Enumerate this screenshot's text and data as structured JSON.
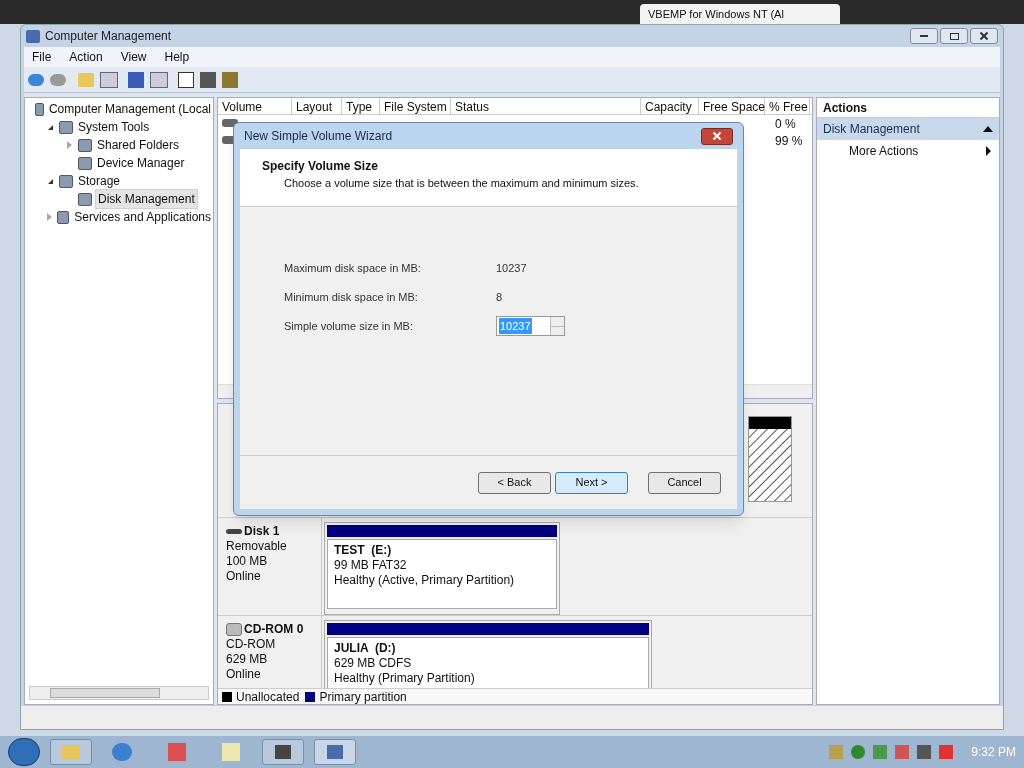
{
  "browser_tab": {
    "title": "VBEMP for Windows NT (Al"
  },
  "window": {
    "title": "Computer Management"
  },
  "menu": [
    "File",
    "Action",
    "View",
    "Help"
  ],
  "tree": [
    {
      "label": "Computer Management (Local",
      "selected": false,
      "children": [
        {
          "label": "System Tools",
          "expanded": true,
          "selected": false,
          "children": [
            {
              "label": "Shared Folders",
              "expanded": false,
              "selected": false
            },
            {
              "label": "Device Manager",
              "selected": false
            }
          ]
        },
        {
          "label": "Storage",
          "expanded": true,
          "selected": false,
          "children": [
            {
              "label": "Disk Management",
              "selected": true
            }
          ]
        },
        {
          "label": "Services and Applications",
          "expanded": false,
          "selected": false
        }
      ]
    }
  ],
  "volume_table": {
    "columns": [
      "Volume",
      "Layout",
      "Type",
      "File System",
      "Status",
      "Capacity",
      "Free Space",
      "% Free"
    ],
    "rows": [
      {
        "percent_free": "0 %"
      },
      {
        "percent_free": "99 %"
      }
    ]
  },
  "disks": [
    {
      "kind": "disk",
      "partition": {
        "color": "#000000"
      }
    },
    {
      "kind": "removable",
      "name": "Disk 1",
      "type": "Removable",
      "size": "100 MB",
      "status": "Online",
      "partition": {
        "color": "#000080",
        "label": "TEST  (E:)",
        "detail": "99 MB FAT32",
        "health": "Healthy (Active, Primary Partition)"
      }
    },
    {
      "kind": "cdrom",
      "name": "CD-ROM 0",
      "type": "CD-ROM",
      "size": "629 MB",
      "status": "Online",
      "partition": {
        "color": "#000080",
        "label": "JULIA  (D:)",
        "detail": "629 MB CDFS",
        "health": "Healthy (Primary Partition)"
      }
    }
  ],
  "legend": [
    {
      "label": "Unallocated",
      "color": "#000000"
    },
    {
      "label": "Primary partition",
      "color": "#000080"
    }
  ],
  "actions": {
    "title": "Actions",
    "section": "Disk Management",
    "expanded": true,
    "items": [
      "More Actions"
    ]
  },
  "dialog": {
    "title": "New Simple Volume Wizard",
    "heading": "Specify Volume Size",
    "subheading": "Choose a volume size that is between the maximum and minimum sizes.",
    "fields": [
      {
        "kind": "text",
        "label": "Maximum disk space in MB:",
        "value": "10237"
      },
      {
        "kind": "text",
        "label": "Minimum disk space in MB:",
        "value": "8"
      },
      {
        "kind": "spinner",
        "label": "Simple volume size in MB:",
        "value": "10237",
        "selected": true
      }
    ],
    "buttons": [
      {
        "label": "< Back",
        "default": false
      },
      {
        "label": "Next >",
        "default": true
      },
      {
        "label": "Cancel",
        "default": false
      }
    ]
  },
  "taskbar": {
    "time": "9:32 PM"
  }
}
